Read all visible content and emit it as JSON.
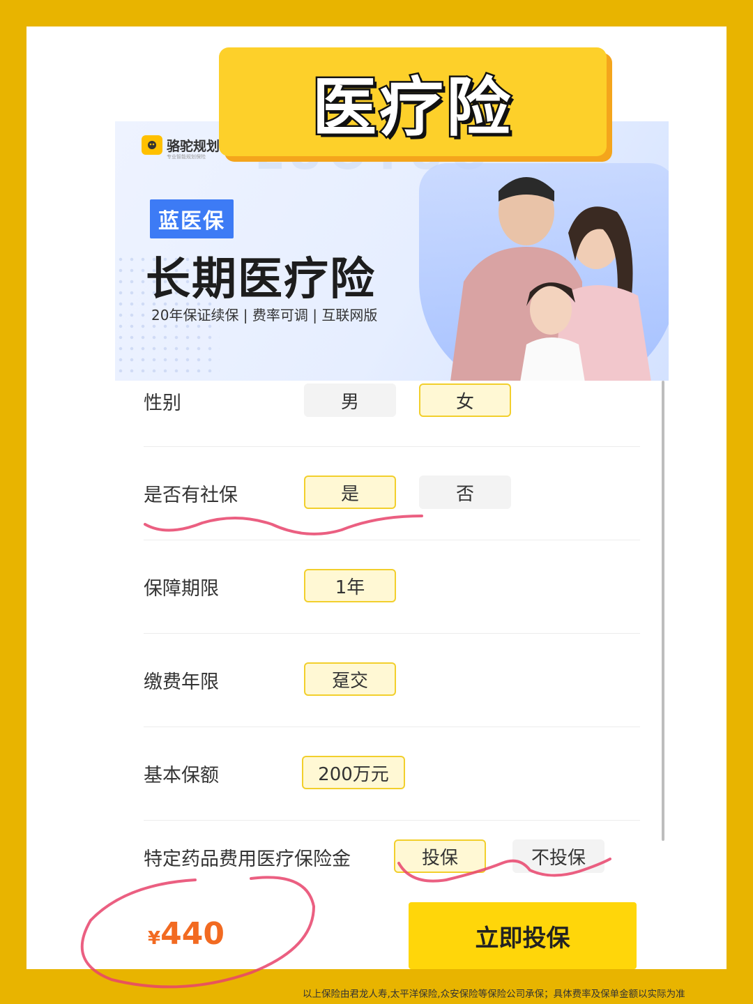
{
  "page": {
    "title": "医疗险"
  },
  "banner": {
    "logo_text": "骆驼规划",
    "logo_sub": "专业智能规划保险",
    "badge": "蓝医保",
    "title": "长期医疗险",
    "subtitle": "20年保证续保 | 费率可调 | 互联网版"
  },
  "form": {
    "rows": [
      {
        "label": "性别",
        "options": [
          {
            "text": "男",
            "selected": false
          },
          {
            "text": "女",
            "selected": true
          }
        ]
      },
      {
        "label": "是否有社保",
        "options": [
          {
            "text": "是",
            "selected": true
          },
          {
            "text": "否",
            "selected": false
          }
        ]
      },
      {
        "label": "保障期限",
        "options": [
          {
            "text": "1年",
            "selected": true
          }
        ]
      },
      {
        "label": "缴费年限",
        "options": [
          {
            "text": "趸交",
            "selected": true
          }
        ]
      },
      {
        "label": "基本保额",
        "options": [
          {
            "text": "200万元",
            "selected": true
          }
        ]
      },
      {
        "label": "特定药品费用医疗保险金",
        "options": [
          {
            "text": "投保",
            "selected": true
          },
          {
            "text": "不投保",
            "selected": false
          }
        ]
      }
    ]
  },
  "footer": {
    "currency": "¥",
    "price": "440",
    "cta_label": "立即投保",
    "note": "以上保险由君龙人寿,太平洋保险,众安保险等保险公司承保；具体费率及保单金额以实际为准"
  },
  "colors": {
    "frame": "#E8B400",
    "accent_yellow": "#FFD60A",
    "price_orange": "#F26A21",
    "selected_border": "#F2CF2C",
    "annotation_red": "#E8436B"
  }
}
